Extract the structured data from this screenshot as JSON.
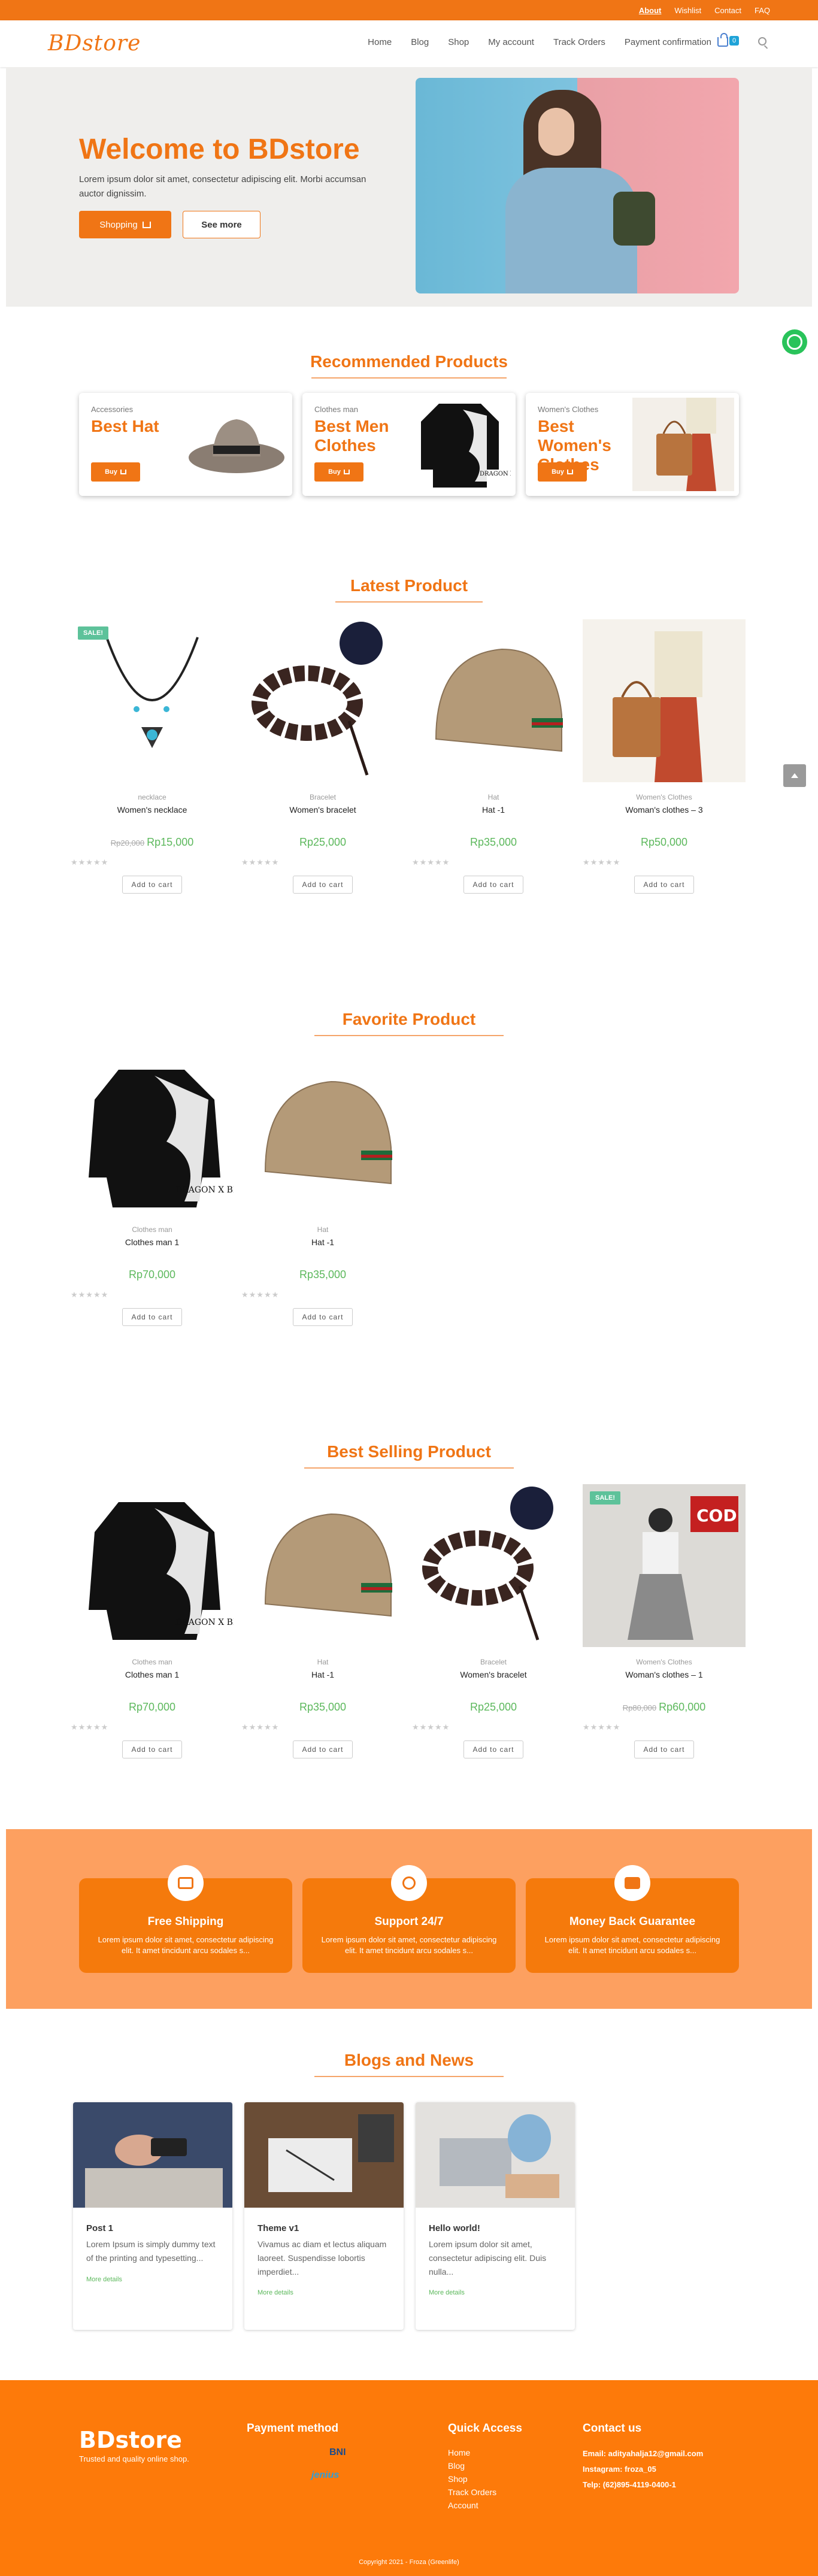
{
  "topbar": {
    "links": [
      "About",
      "Wishlist",
      "Contact",
      "FAQ"
    ]
  },
  "logo": "BDstore",
  "nav": {
    "items": [
      "Home",
      "Blog",
      "Shop",
      "My account",
      "Track Orders",
      "Payment confirmation"
    ],
    "cart_count": "0"
  },
  "hero": {
    "title": "Welcome to BDstore",
    "text": "Lorem ipsum dolor sit amet, consectetur adipiscing elit. Morbi accumsan auctor dignissim.",
    "shop_label": "Shopping",
    "more_label": "See more"
  },
  "recommended": {
    "title": "Recommended Products",
    "cards": [
      {
        "category": "Accessories",
        "name": "Best Hat",
        "button": "Buy"
      },
      {
        "category": "Clothes man",
        "name": "Best Men Clothes",
        "button": "Buy"
      },
      {
        "category": "Women's Clothes",
        "name": "Best Women's Clothes",
        "button": "Buy"
      }
    ]
  },
  "latest": {
    "title": "Latest Product",
    "products": [
      {
        "category": "necklace",
        "name": "Women's necklace",
        "old_price": "Rp20,000",
        "price": "Rp15,000",
        "sale": "SALE!",
        "add": "Add to cart"
      },
      {
        "category": "Bracelet",
        "name": "Women's bracelet",
        "old_price": "",
        "price": "Rp25,000",
        "sale": "",
        "add": "Add to cart"
      },
      {
        "category": "Hat",
        "name": "Hat -1",
        "old_price": "",
        "price": "Rp35,000",
        "sale": "",
        "add": "Add to cart"
      },
      {
        "category": "Women's Clothes",
        "name": "Woman's clothes – 3",
        "old_price": "",
        "price": "Rp50,000",
        "sale": "",
        "add": "Add to cart"
      }
    ]
  },
  "favorite": {
    "title": "Favorite Product",
    "products": [
      {
        "category": "Clothes man",
        "name": "Clothes man 1",
        "price": "Rp70,000",
        "add": "Add to cart",
        "img_text": "DRAGON X BLACK"
      },
      {
        "category": "Hat",
        "name": "Hat -1",
        "price": "Rp35,000",
        "add": "Add to cart"
      }
    ]
  },
  "bestselling": {
    "title": "Best Selling Product",
    "products": [
      {
        "category": "Clothes man",
        "name": "Clothes man 1",
        "old_price": "",
        "price": "Rp70,000",
        "sale": "",
        "add": "Add to cart",
        "img_text": "DRAGON X BLACK"
      },
      {
        "category": "Hat",
        "name": "Hat -1",
        "old_price": "",
        "price": "Rp35,000",
        "sale": "",
        "add": "Add to cart"
      },
      {
        "category": "Bracelet",
        "name": "Women's bracelet",
        "old_price": "",
        "price": "Rp25,000",
        "sale": "",
        "add": "Add to cart"
      },
      {
        "category": "Women's Clothes",
        "name": "Woman's clothes – 1",
        "old_price": "Rp80,000",
        "price": "Rp60,000",
        "sale": "SALE!",
        "add": "Add to cart",
        "img_text": "COD"
      }
    ]
  },
  "rec_img_text": "DRAGON X BLACK",
  "features": [
    {
      "title": "Free Shipping",
      "text": "Lorem ipsum dolor sit amet, consectetur adipiscing elit. It amet tincidunt arcu sodales s..."
    },
    {
      "title": "Support 24/7",
      "text": "Lorem ipsum dolor sit amet, consectetur adipiscing elit. It amet tincidunt arcu sodales s..."
    },
    {
      "title": "Money Back Guarantee",
      "text": "Lorem ipsum dolor sit amet, consectetur adipiscing elit. It amet tincidunt arcu sodales s..."
    }
  ],
  "blogs": {
    "title": "Blogs and News",
    "posts": [
      {
        "title": "Post 1",
        "text": "Lorem Ipsum is simply dummy text of the printing and typesetting...",
        "more": "More details"
      },
      {
        "title": "Theme v1",
        "text": "Vivamus ac diam et lectus aliquam laoreet. Suspendisse lobortis imperdiet...",
        "more": "More details"
      },
      {
        "title": "Hello world!",
        "text": "Lorem ipsum dolor sit amet, consectetur adipiscing elit. Duis nulla...",
        "more": "More details"
      }
    ]
  },
  "footer": {
    "brand": "BDstore",
    "tagline": "Trusted and quality online shop.",
    "payment_title": "Payment method",
    "payment_logos": [
      "BNI",
      "jenius"
    ],
    "quick_title": "Quick Access",
    "quick_links": [
      "Home",
      "Blog",
      "Shop",
      "Track Orders",
      "Account"
    ],
    "contact_title": "Contact us",
    "email": "Email: adityahalja12@gmail.com",
    "instagram": "Instagram: froza_05",
    "phone": "Telp: (62)895-4119-0400-1",
    "copyright": "Copyright 2021 - Froza (Greenlife)"
  },
  "colors": {
    "accent": "#f07515",
    "price": "#5cb85c",
    "sale": "#5dc29a",
    "feature_bg": "#fda060"
  }
}
